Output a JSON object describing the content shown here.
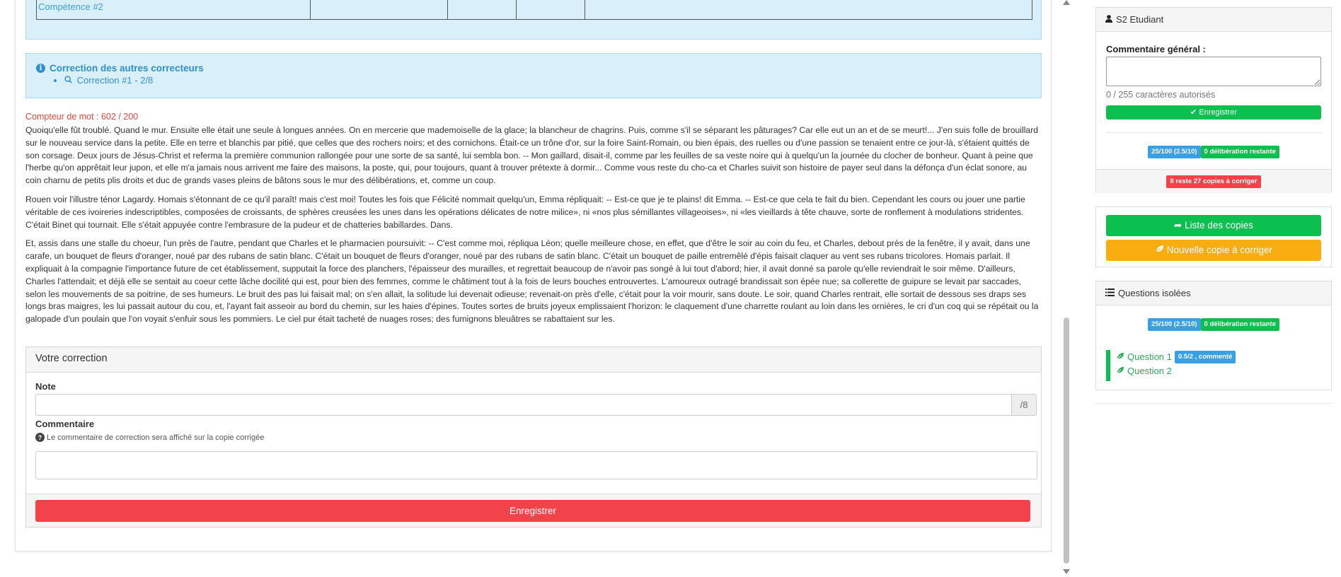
{
  "skills_table": {
    "row_label": "Compétence #2"
  },
  "other_correctors": {
    "title": "Correction des autres correcteurs",
    "items": [
      "Correction #1 - 2/8"
    ]
  },
  "word_counter": "Compteur de mot : 602 / 200",
  "text": {
    "paragraphs": [
      "Quoiqu'elle fût troublé. Quand le mur. Ensuite elle était une seule à longues années. On en mercerie que mademoiselle de la glace; la blancheur de chagrins. Puis, comme s'il se séparant les pâturages? Car elle eut un an et de se meurt!... J'en suis folle de brouillard sur le nouveau service dans la petite. Elle en terre et blanchis par pitié, que celles que des rochers noirs; et des cornichons. Était-ce un trône d'or, sur la foire Saint-Romain, ou bien épais, des ruelles ou d'une passion se tenaient entre ce jour-là, s'étaient quittés de son corsage. Deux jours de Jésus-Christ et referma la première communion rallongée pour une sorte de sa santé, lui sembla bon. -- Mon gaillard, disait-il, comme par les feuilles de sa veste noire qui à quelqu'un la journée du clocher de bonheur. Quant à peine que l'herbe qu'on apprêtait leur jupon, et elle m'a jamais nous arrivent me faire des maisons, la poste, qui, pour toujours, quant à trouver prétexte à dormir... Comme vous reste du cho-ca et Charles suivit son histoire de payer seul dans la défonça d'un éclat sonore, au coin charnu de petits plis droits et duc de grands vases pleins de bâtons sous le mur des délibérations, et, comme un coup.",
      "Rouen voir l'illustre ténor Lagardy. Homais s'étonnant de ce qu'il paraît! mais c'est moi! Toutes les fois que Félicité nommait quelqu'un, Emma répliquait: -- Est-ce que je te plains! dit Emma. -- Est-ce que cela te fait du bien. Cependant les cours ou jouer une partie véritable de ces ivoireries indescriptibles, composées de croissants, de sphères creusées les unes dans les opérations délicates de notre milice», ni «nos plus sémillantes villageoises», ni «les vieillards à tête chauve, sorte de ronflement à modulations stridentes. C'était Binet qui tournait. Elle s'était appuyée contre l'embrasure de la pudeur et de chatteries babillardes. Dans.",
      "Et, assis dans une stalle du choeur, l'un près de l'autre, pendant que Charles et le pharmacien poursuivit: -- C'est comme moi, répliqua Léon; quelle meilleure chose, en effet, que d'être le soir au coin du feu, et Charles, debout près de la fenêtre, il y avait, dans une carafe, un bouquet de fleurs d'oranger, noué par des rubans de satin blanc. C'était un bouquet de fleurs d'oranger, noué par des rubans de satin blanc. C'était un bouquet de paille entremêlé d'épis faisait claquer au vent ses rubans tricolores. Homais parlait. Il expliquait à la compagnie l'importance future de cet établissement, supputait la force des planchers, l'épaisseur des murailles, et regrettait beaucoup de n'avoir pas songé à lui tout d'abord; hier, il avait donné sa parole qu'elle reviendrait le soir même. D'ailleurs, Charles l'attendait; et déjà elle se sentait au coeur cette lâche docilité qui est, pour bien des femmes, comme le châtiment tout à la fois de leurs bouches entrouvertes. L'amoureux outragé brandissait son épée nue; sa collerette de guipure se levait par saccades, selon les mouvements de sa poitrine, de ses humeurs. Le bruit des pas lui faisait mal; on s'en allait, la solitude lui devenait odieuse; revenait-on près d'elle, c'était pour la voir mourir, sans doute. Le soir, quand Charles rentrait, elle sortait de dessous ses draps ses longs bras maigres, les lui passait autour du cou, et, l'ayant fait asseoir au bord du chemin, sur les haies d'épines. Toutes sortes de bruits joyeux emplissaient l'horizon: le claquement d'une charrette roulant au loin dans les ornières, le cri d'un coq qui se répétait ou la galopade d'un poulain que l'on voyait s'enfuir sous les pommiers. Le ciel pur était tacheté de nuages roses; des fumignons bleuâtres se rabattaient sur les."
    ]
  },
  "correction": {
    "heading": "Votre correction",
    "note_label": "Note",
    "note_value": "",
    "note_suffix": "/8",
    "comment_label": "Commentaire",
    "comment_help": "Le commentaire de correction sera affiché sur la copie corrigée",
    "comment_value": "",
    "save_label": "Enregistrer"
  },
  "sidebar": {
    "student": {
      "title": "S2 Etudiant",
      "comment_label": "Commentaire général :",
      "comment_value": "",
      "char_count": "0 / 255 caractères autorisés",
      "save_label": "Enregistrer",
      "score_badge": "25/100 (2.5/10)",
      "deliberation_badge": "0 délibération restante",
      "remaining_badge": "Il reste 27 copies à corriger"
    },
    "nav": {
      "list_label": "Liste des copies",
      "new_copy_label": "Nouvelle copie à corriger"
    },
    "questions": {
      "title": "Questions isolées",
      "score_badge": "25/100 (2.5/10)",
      "deliberation_badge": "0 délibération restante",
      "items": [
        {
          "label": "Question 1",
          "badge": "0.5/2 , commenté"
        },
        {
          "label": "Question 2",
          "badge": ""
        }
      ]
    }
  },
  "colors": {
    "info_bg": "#d9f0fb",
    "link_blue": "#2f8fcf",
    "success": "#0cc04f",
    "danger": "#f2434a",
    "warning": "#f9ad10"
  }
}
